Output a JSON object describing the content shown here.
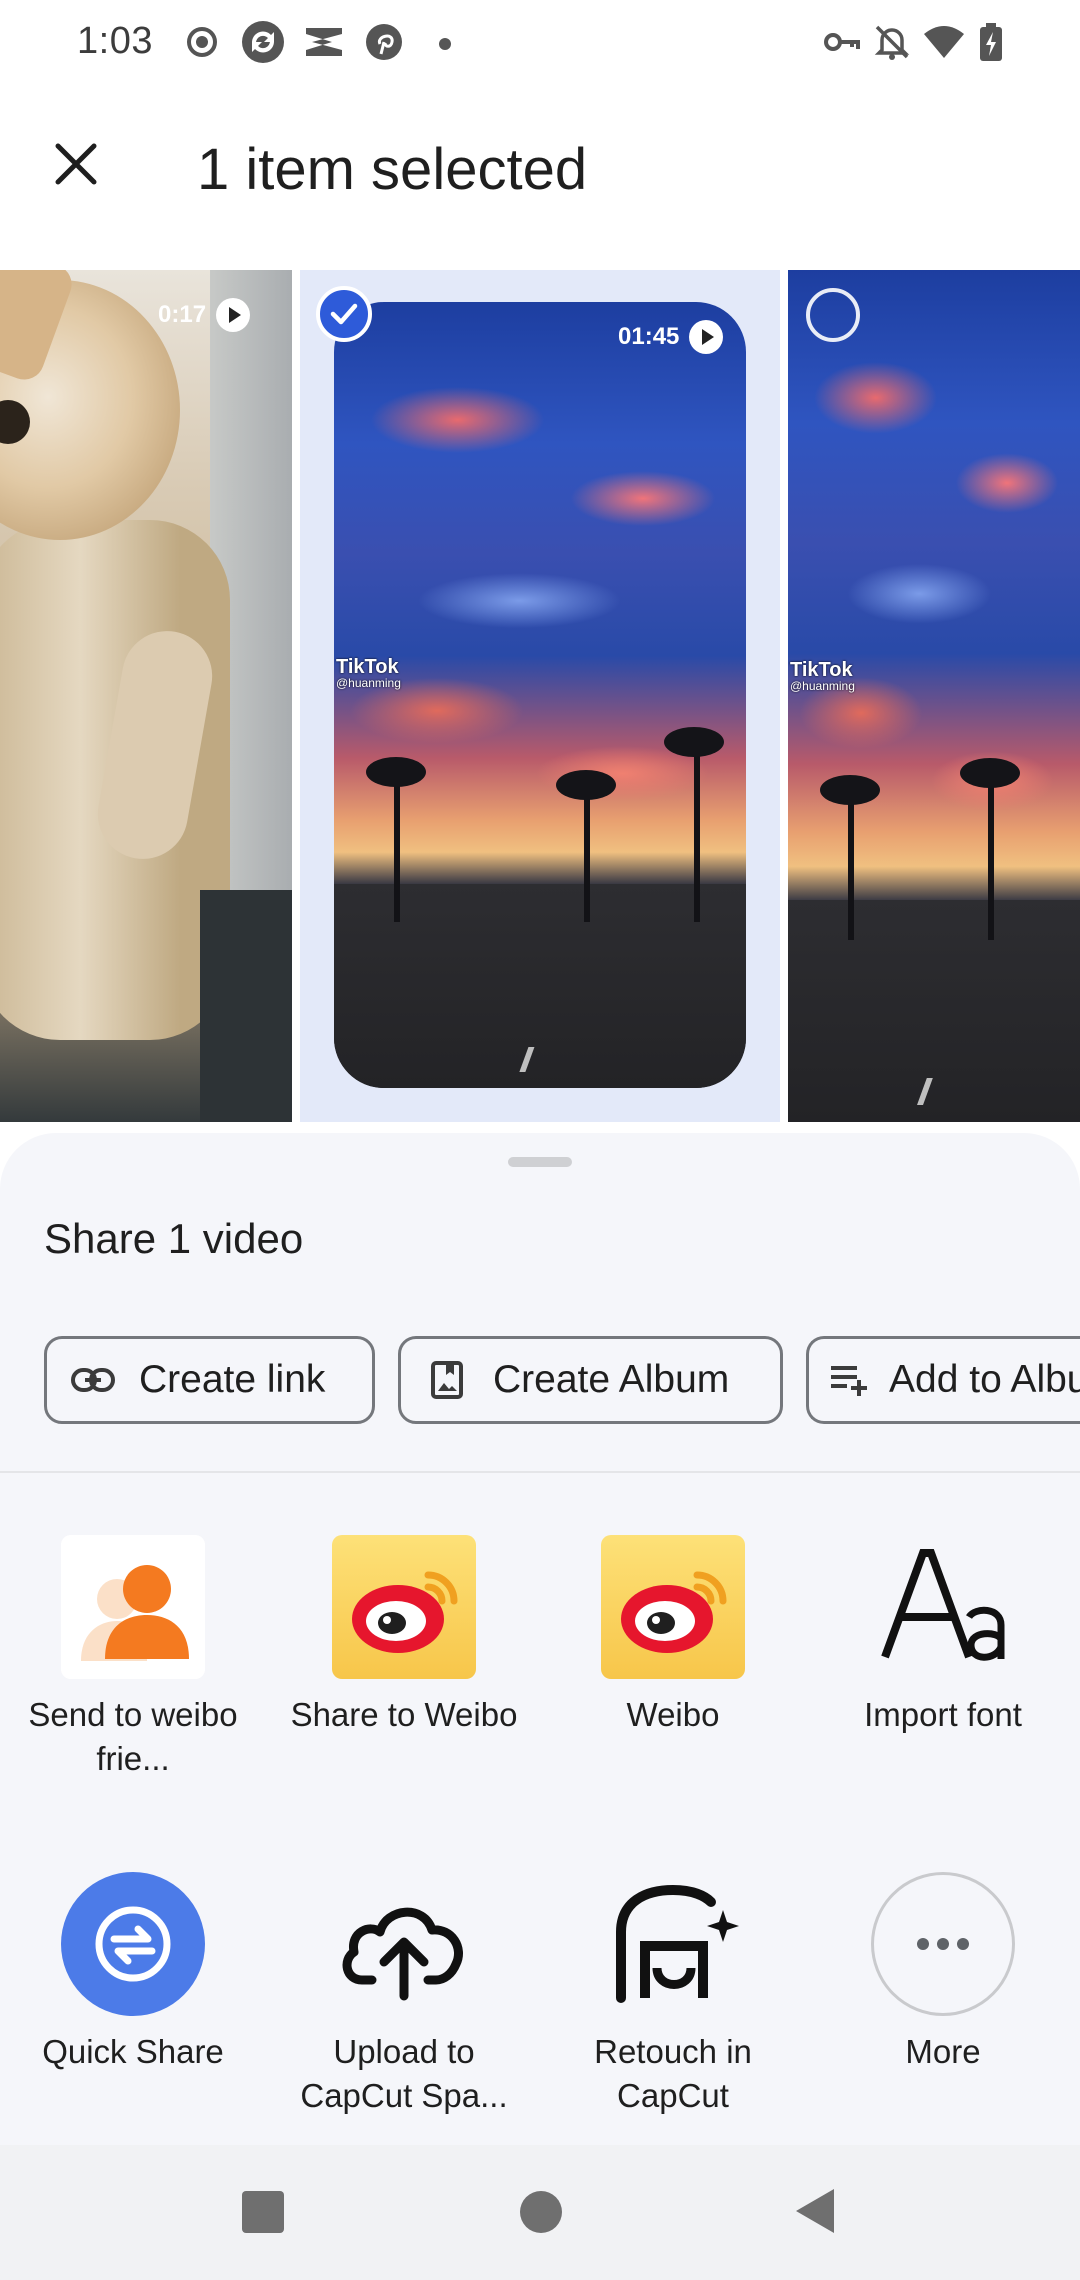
{
  "status_bar": {
    "time": "1:03",
    "left_icons": [
      "record-icon",
      "sync-app-icon",
      "capcut-icon",
      "pinterest-icon",
      "dot-icon"
    ],
    "right_icons": [
      "vpn-key-icon",
      "notifications-off-icon",
      "wifi-icon",
      "battery-charging-icon"
    ]
  },
  "header": {
    "close_icon": "close-icon",
    "title": "1 item selected"
  },
  "media": {
    "items": [
      {
        "duration": "0:17",
        "selected": false
      },
      {
        "duration": "01:45",
        "selected": true,
        "watermark": "TikTok",
        "watermark_user": "@huanming"
      },
      {
        "duration": "",
        "selected": false,
        "watermark": "TikTok",
        "watermark_user": "@huanming"
      }
    ]
  },
  "share_sheet": {
    "title": "Share 1 video",
    "actions": [
      {
        "label": "Create link",
        "icon": "link-icon"
      },
      {
        "label": "Create Album",
        "icon": "album-icon"
      },
      {
        "label": "Add to Album",
        "icon": "playlist-add-icon"
      }
    ],
    "targets_row1": [
      {
        "label": "Send to weibo frie...",
        "icon": "weibo-friends-icon"
      },
      {
        "label": "Share to Weibo",
        "icon": "weibo-icon"
      },
      {
        "label": "Weibo",
        "icon": "weibo-icon"
      },
      {
        "label": "Import font",
        "icon": "font-icon"
      }
    ],
    "targets_row2": [
      {
        "label": "Quick Share",
        "icon": "quick-share-icon"
      },
      {
        "label": "Upload to CapCut Spa...",
        "icon": "cloud-upload-icon"
      },
      {
        "label": "Retouch in CapCut",
        "icon": "capcut-retouch-icon"
      },
      {
        "label": "More",
        "icon": "more-icon"
      }
    ]
  },
  "nav": {
    "recents": "recents-icon",
    "home": "home-icon",
    "back": "back-icon"
  },
  "colors": {
    "accent": "#2e5bd9",
    "selected_bg": "#e3e9f9",
    "sheet_bg": "#f5f6fa",
    "weibo_yellow": "#f7c64a",
    "weibo_red": "#e6162d"
  }
}
